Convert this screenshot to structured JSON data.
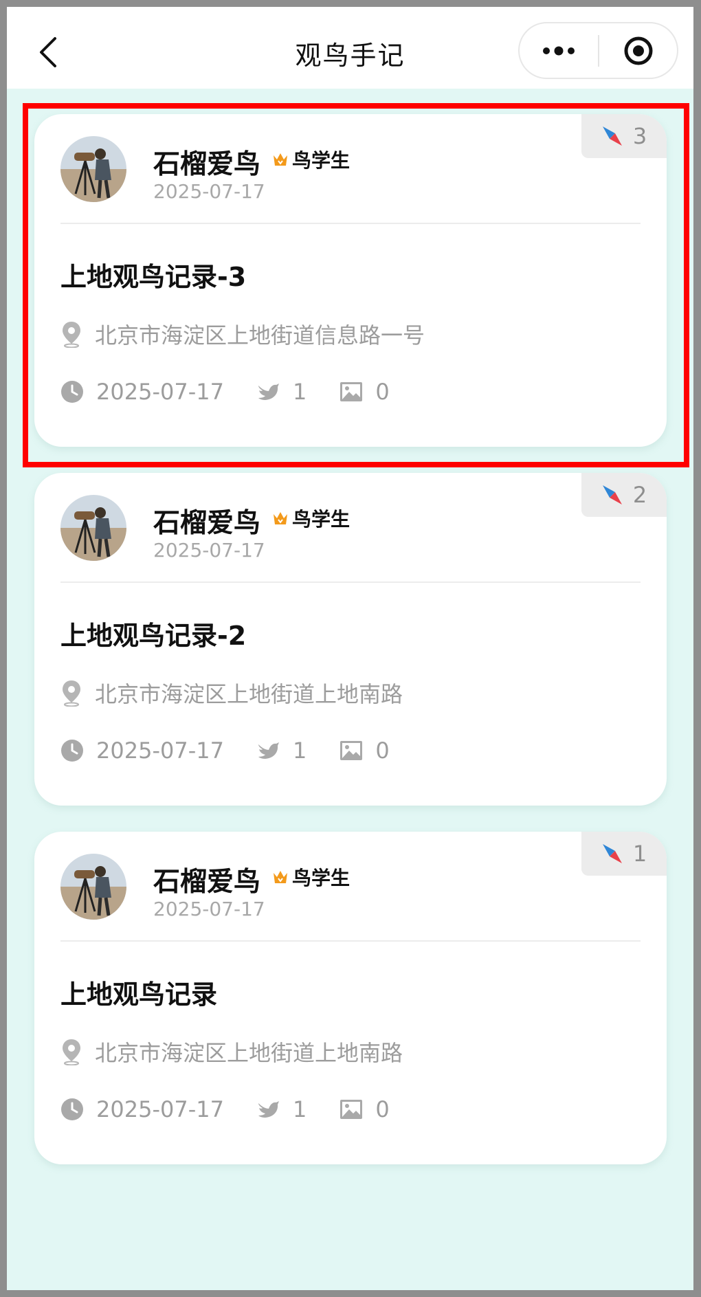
{
  "navbar": {
    "title": "观鸟手记",
    "back_icon": "chevron-left-icon",
    "more_icon": "more-dots-icon",
    "close_icon": "target-circle-icon"
  },
  "colors": {
    "background": "#e2f7f4",
    "highlight": "#ff0000",
    "crown": "#f39a1b",
    "compass_red": "#e8414b",
    "compass_blue": "#2f86d6"
  },
  "records": [
    {
      "seq": "3",
      "user_name": "石榴爱鸟",
      "badge": "鸟学生",
      "post_date": "2025-07-17",
      "title": "上地观鸟记录-3",
      "location": "北京市海淀区上地街道信息路一号",
      "date": "2025-07-17",
      "bird_count": "1",
      "photo_count": "0",
      "highlighted": true
    },
    {
      "seq": "2",
      "user_name": "石榴爱鸟",
      "badge": "鸟学生",
      "post_date": "2025-07-17",
      "title": "上地观鸟记录-2",
      "location": "北京市海淀区上地街道上地南路",
      "date": "2025-07-17",
      "bird_count": "1",
      "photo_count": "0",
      "highlighted": false
    },
    {
      "seq": "1",
      "user_name": "石榴爱鸟",
      "badge": "鸟学生",
      "post_date": "2025-07-17",
      "title": "上地观鸟记录",
      "location": "北京市海淀区上地街道上地南路",
      "date": "2025-07-17",
      "bird_count": "1",
      "photo_count": "0",
      "highlighted": false
    }
  ]
}
